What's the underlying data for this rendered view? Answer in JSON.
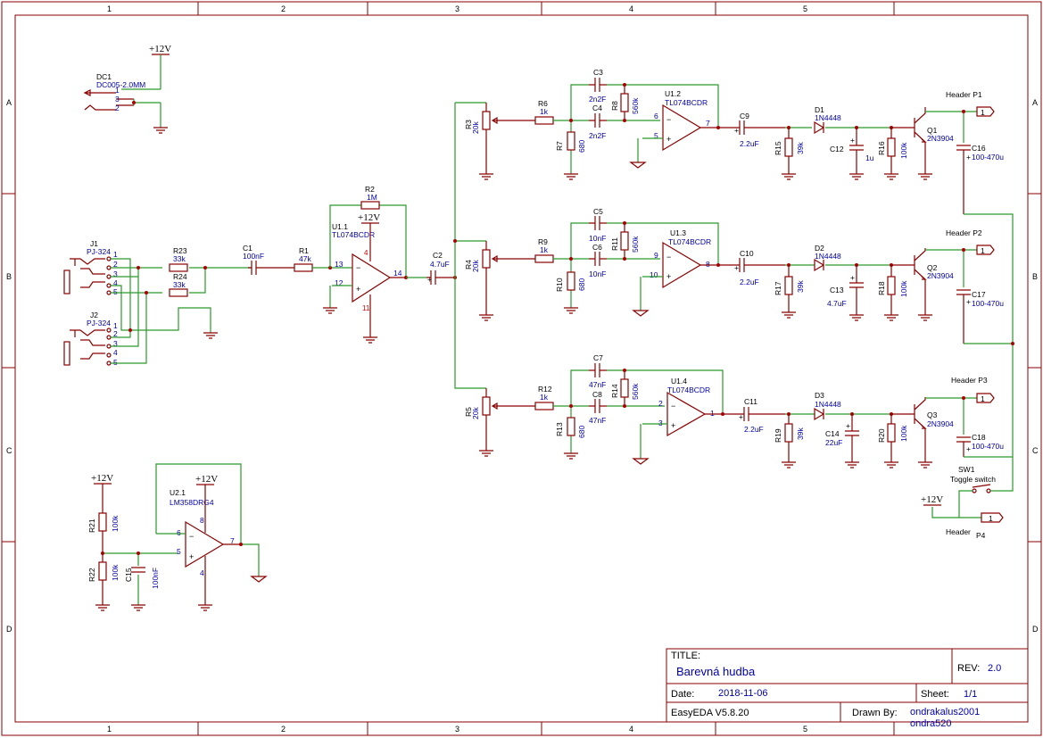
{
  "frame": {
    "cols": [
      "1",
      "2",
      "3",
      "4",
      "5"
    ],
    "rows": [
      "A",
      "B",
      "C",
      "D"
    ]
  },
  "components": {
    "dc1": {
      "ref": "DC1",
      "value": "DC005-2.0MM",
      "pins": [
        "1",
        "3",
        "2"
      ]
    },
    "pwr_top": "+12V",
    "pwr_u11": "+12V",
    "pwr_r21": "+12V",
    "pwr_u21": "+12V",
    "pwr_sw": "+12V",
    "j1": {
      "ref": "J1",
      "value": "PJ-324",
      "pins": [
        "1",
        "2",
        "3",
        "4",
        "5"
      ]
    },
    "j2": {
      "ref": "J2",
      "value": "PJ-324",
      "pins": [
        "1",
        "2",
        "3",
        "4",
        "5"
      ]
    },
    "r23": {
      "ref": "R23",
      "value": "33k"
    },
    "r24": {
      "ref": "R24",
      "value": "33k"
    },
    "c1": {
      "ref": "C1",
      "value": "100nF"
    },
    "r1": {
      "ref": "R1",
      "value": "47k"
    },
    "r2": {
      "ref": "R2",
      "value": "1M"
    },
    "u11": {
      "ref": "U1.1",
      "value": "TL074BCDR",
      "pins": [
        "13",
        "12",
        "14",
        "4",
        "11"
      ]
    },
    "c2": {
      "ref": "C2",
      "value": "4.7uF"
    },
    "r3": {
      "ref": "R3",
      "value": "20k"
    },
    "r4": {
      "ref": "R4",
      "value": "20k"
    },
    "r5": {
      "ref": "R5",
      "value": "20k"
    },
    "r6": {
      "ref": "R6",
      "value": "1k"
    },
    "r9": {
      "ref": "R9",
      "value": "1k"
    },
    "r12": {
      "ref": "R12",
      "value": "1k"
    },
    "r7": {
      "ref": "R7",
      "value": "680"
    },
    "r10": {
      "ref": "R10",
      "value": "680"
    },
    "r13": {
      "ref": "R13",
      "value": "680"
    },
    "c3": {
      "ref": "C3",
      "value": "2n2F"
    },
    "c4": {
      "ref": "C4",
      "value": "2n2F"
    },
    "c5": {
      "ref": "C5",
      "value": "10nF"
    },
    "c6": {
      "ref": "C6",
      "value": "10nF"
    },
    "c7": {
      "ref": "C7",
      "value": "47nF"
    },
    "c8": {
      "ref": "C8",
      "value": "47nF"
    },
    "r8": {
      "ref": "R8",
      "value": "560k"
    },
    "r11": {
      "ref": "R11",
      "value": "560k"
    },
    "r14": {
      "ref": "R14",
      "value": "560k"
    },
    "u12": {
      "ref": "U1.2",
      "value": "TL074BCDR",
      "pins": [
        "6",
        "5",
        "7"
      ]
    },
    "u13": {
      "ref": "U1.3",
      "value": "TL074BCDR",
      "pins": [
        "9",
        "10",
        "8"
      ]
    },
    "u14": {
      "ref": "U1.4",
      "value": "TL074BCDR",
      "pins": [
        "2",
        "3",
        "1"
      ]
    },
    "c9": {
      "ref": "C9",
      "value": "2.2uF"
    },
    "c10": {
      "ref": "C10",
      "value": "2.2uF"
    },
    "c11": {
      "ref": "C11",
      "value": "2.2uF"
    },
    "d1": {
      "ref": "D1",
      "value": "1N4448"
    },
    "d2": {
      "ref": "D2",
      "value": "1N4448"
    },
    "d3": {
      "ref": "D3",
      "value": "1N4448"
    },
    "r15": {
      "ref": "R15",
      "value": "39k"
    },
    "r17": {
      "ref": "R17",
      "value": "39k"
    },
    "r19": {
      "ref": "R19",
      "value": "39k"
    },
    "c12": {
      "ref": "C12",
      "value": "1u"
    },
    "c13": {
      "ref": "C13",
      "value": "4.7uF"
    },
    "c14": {
      "ref": "C14",
      "value": "22uF"
    },
    "r16": {
      "ref": "R16",
      "value": "100k"
    },
    "r18": {
      "ref": "R18",
      "value": "100k"
    },
    "r20": {
      "ref": "R20",
      "value": "100k"
    },
    "q1": {
      "ref": "Q1",
      "value": "2N3904"
    },
    "q2": {
      "ref": "Q2",
      "value": "2N3904"
    },
    "q3": {
      "ref": "Q3",
      "value": "2N3904"
    },
    "c16": {
      "ref": "C16",
      "value": "100-470u"
    },
    "c17": {
      "ref": "C17",
      "value": "100-470u"
    },
    "c18": {
      "ref": "C18",
      "value": "100-470u"
    },
    "p1": {
      "label": "Header P1",
      "pin": "1"
    },
    "p2": {
      "label": "Header P2",
      "pin": "1"
    },
    "p3": {
      "label": "Header P3",
      "pin": "1"
    },
    "p4": {
      "label": "Header",
      "ref": "P4",
      "pin": "1"
    },
    "sw1": {
      "ref": "SW1",
      "value": "Toggle switch"
    },
    "r21": {
      "ref": "R21",
      "value": "100k"
    },
    "r22": {
      "ref": "R22",
      "value": "100k"
    },
    "c15": {
      "ref": "C15",
      "value": "100nF"
    },
    "u21": {
      "ref": "U2.1",
      "value": "LM358DRG4",
      "pins": [
        "6",
        "5",
        "7",
        "8",
        "4"
      ]
    }
  },
  "title_block": {
    "title_label": "TITLE:",
    "title": "Barevná hudba",
    "rev_label": "REV:",
    "rev": "2.0",
    "date_label": "Date:",
    "date": "2018-11-06",
    "sheet_label": "Sheet:",
    "sheet": "1/1",
    "tool": "EasyEDA V5.8.20",
    "drawn_label": "Drawn By:",
    "drawn_1": "ondrakalus2001",
    "drawn_2": "ondra520"
  },
  "colors": {
    "wire": "#2a9a2a",
    "component": "#8a0000",
    "designator": "#000000",
    "pin_number": "#0000aa",
    "value_text": "#0000aa"
  }
}
